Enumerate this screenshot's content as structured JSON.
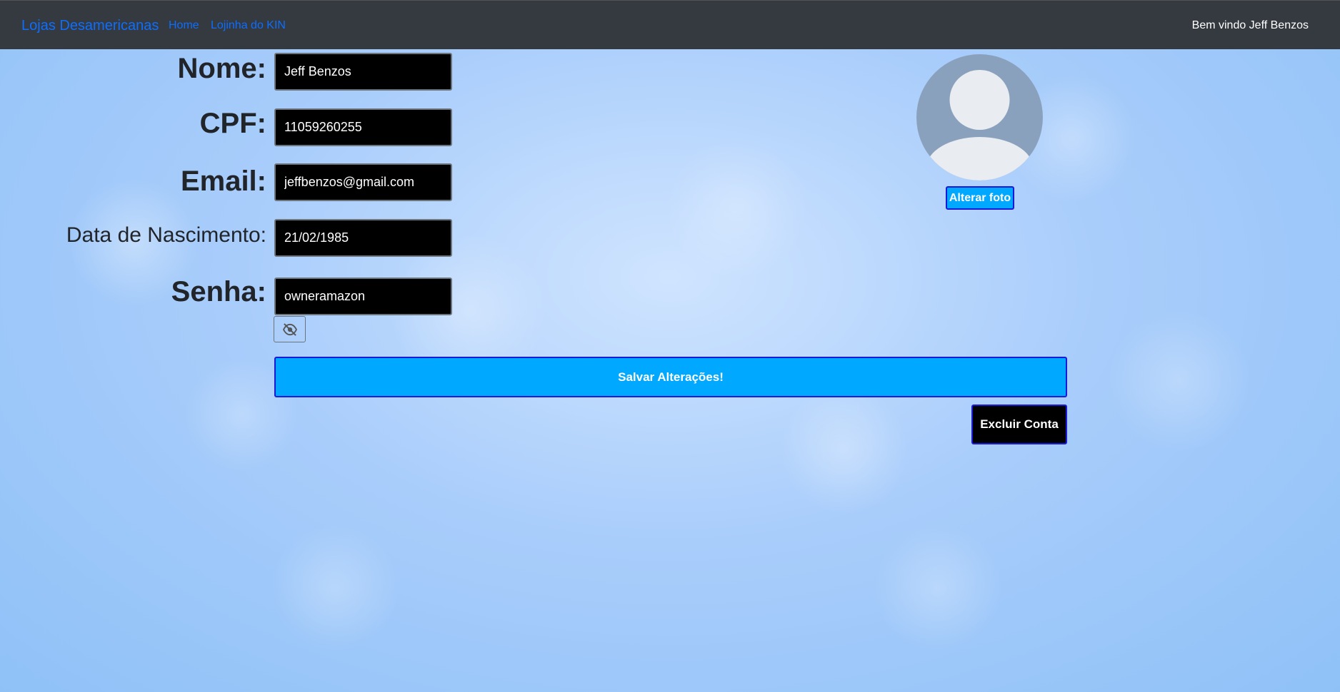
{
  "navbar": {
    "brand": "Lojas Desamericanas",
    "links": [
      {
        "label": "Home"
      },
      {
        "label": "Lojinha do KIN"
      }
    ],
    "welcome": "Bem vindo Jeff Benzos"
  },
  "form": {
    "nome": {
      "label": "Nome:",
      "value": "Jeff Benzos"
    },
    "cpf": {
      "label": "CPF:",
      "value": "11059260255"
    },
    "email": {
      "label": "Email:",
      "value": "jeffbenzos@gmail.com"
    },
    "nascimento": {
      "label": "Data de Nascimento:",
      "value": "21/02/1985"
    },
    "senha": {
      "label": "Senha:",
      "value": "owneramazon"
    },
    "toggle_password_icon": "eye-slash-icon",
    "save_label": "Salvar Alterações!",
    "delete_label": "Excluir Conta"
  },
  "profile": {
    "change_photo_label": "Alterar foto",
    "avatar_icon": "default-user-avatar"
  },
  "colors": {
    "navbar_bg": "#343a40",
    "link": "#0d6efd",
    "primary_button": "#00a8ff",
    "button_border": "#1a1ad8",
    "field_bg": "#000000"
  }
}
